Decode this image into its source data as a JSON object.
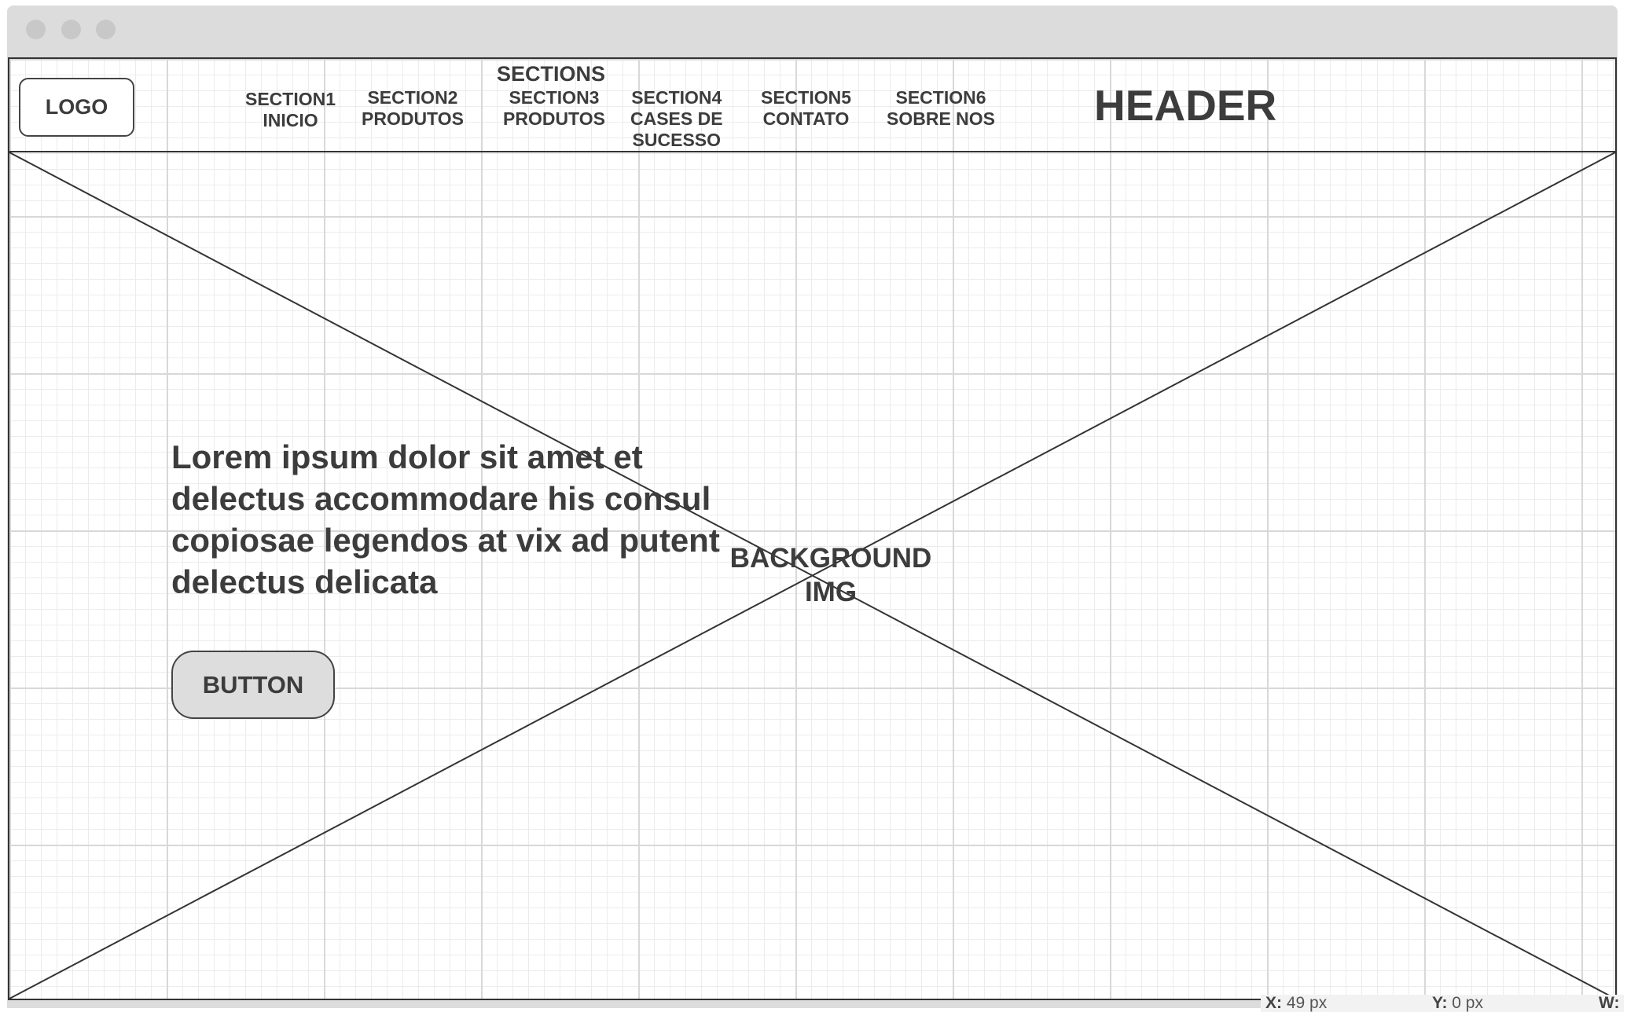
{
  "header": {
    "logo": "LOGO",
    "sections_label": "SECTIONS",
    "title": "HEADER",
    "nav": [
      {
        "line1": "SECTION1",
        "line2": "INICIO"
      },
      {
        "line1": "SECTION2",
        "line2": "PRODUTOS"
      },
      {
        "line1": "SECTION3",
        "line2": "PRODUTOS"
      },
      {
        "line1": "SECTION4",
        "line2": "CASES DE",
        "line3": "SUCESSO"
      },
      {
        "line1": "SECTION5",
        "line2": "CONTATO"
      },
      {
        "line1": "SECTION6",
        "line2": "SOBRE NOS"
      }
    ]
  },
  "hero": {
    "background_label_line1": "BACKGROUND",
    "background_label_line2": "IMG",
    "text": "Lorem ipsum dolor sit amet et delectus accommodare his consul copiosae legendos at vix ad putent delectus delicata",
    "button_label": "BUTTON"
  },
  "status_bar": {
    "x_label": "X:",
    "x_value": "49 px",
    "y_label": "Y:",
    "y_value": "0 px",
    "w_label": "W:"
  }
}
